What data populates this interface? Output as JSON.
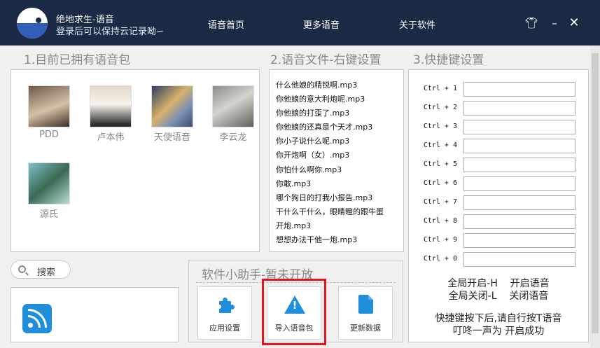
{
  "header": {
    "title": "绝地求生-语音",
    "subtitle": "登录后可以保持云记录呦~",
    "nav": [
      "语音首页",
      "更多语音",
      "关于软件"
    ]
  },
  "sections": {
    "owned_packs": "1.目前已拥有语音包",
    "voice_files": "2.语音文件-右键设置",
    "hotkeys": "3.快捷键设置"
  },
  "voice_packs": [
    {
      "name": "PDD"
    },
    {
      "name": "卢本伟"
    },
    {
      "name": "天使语音"
    },
    {
      "name": "李云龙"
    },
    {
      "name": "源氏"
    }
  ],
  "voice_files": [
    "什么他娘的精锐啊.mp3",
    "你他娘的意大利炮呢.mp3",
    "你他娘的打歪了.mp3",
    "你他娘的还真是个天才.mp3",
    "你小子说什么呢.mp3",
    "你开炮啊（女）.mp3",
    "你怕什么啊你.mp3",
    "你敢.mp3",
    "哪个狗日的打我小报告.mp3",
    "干什么干什么，眼睛瞪的跟牛蛋",
    "开炮.mp3",
    "想想办法干他一炮.mp3"
  ],
  "hotkeys": [
    {
      "label": "Ctrl + 1",
      "value": ""
    },
    {
      "label": "Ctrl + 2",
      "value": ""
    },
    {
      "label": "Ctrl + 3",
      "value": ""
    },
    {
      "label": "Ctrl + 4",
      "value": ""
    },
    {
      "label": "Ctrl + 5",
      "value": ""
    },
    {
      "label": "Ctrl + 6",
      "value": ""
    },
    {
      "label": "Ctrl + 7",
      "value": ""
    },
    {
      "label": "Ctrl + 8",
      "value": ""
    },
    {
      "label": "Ctrl + 9",
      "value": ""
    },
    {
      "label": "Ctrl + 0",
      "value": ""
    }
  ],
  "hotkey_notes": {
    "global_on": "全局开启-H    开启语音",
    "global_off": "全局关闭-L    关闭语音",
    "tip_line1": "快捷键按下后,请自行按T语音",
    "tip_line2": "叮咚一声为 开启成功"
  },
  "search": {
    "label": "搜索"
  },
  "helper": {
    "title": "软件小助手-暂未开放",
    "buttons": [
      {
        "label": "应用设置",
        "icon": "puzzle-icon"
      },
      {
        "label": "导入语音包",
        "icon": "warning-icon"
      },
      {
        "label": "更新数据",
        "icon": "document-icon"
      }
    ]
  },
  "colors": {
    "header_bg": "#1b2a44",
    "accent": "#1f8fdc",
    "highlight": "#e8141b"
  }
}
